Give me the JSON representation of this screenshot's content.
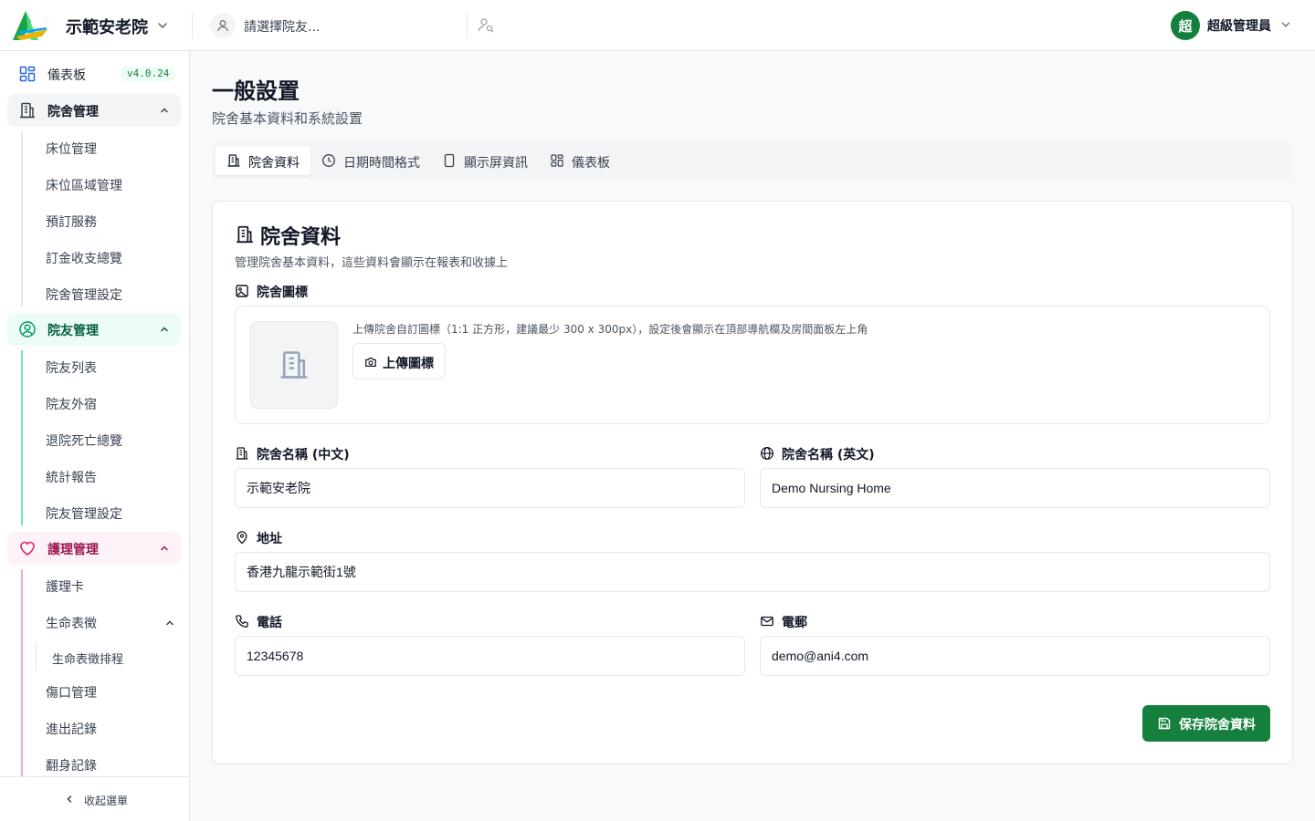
{
  "header": {
    "app_title": "示範安老院",
    "resident_placeholder": "請選擇院友...",
    "user_initial": "超",
    "user_name": "超級管理員"
  },
  "sidebar": {
    "dashboard_label": "儀表板",
    "version": "v4.0.24",
    "groups": [
      {
        "label": "院舍管理",
        "items": [
          "床位管理",
          "床位區域管理",
          "預訂服務",
          "訂金收支總覽",
          "院舍管理設定"
        ]
      },
      {
        "label": "院友管理",
        "items": [
          "院友列表",
          "院友外宿",
          "退院死亡總覽",
          "統計報告",
          "院友管理設定"
        ]
      },
      {
        "label": "護理管理",
        "items": [
          "護理卡",
          "生命表徵",
          "生命表徵排程",
          "傷口管理",
          "進出記錄",
          "翻身記錄"
        ]
      }
    ],
    "collapse_label": "收起選單"
  },
  "page": {
    "title": "一般設置",
    "subtitle": "院舍基本資料和系統設置"
  },
  "tabs": [
    "院舍資料",
    "日期時間格式",
    "顯示屏資訊",
    "儀表板"
  ],
  "card": {
    "title": "院舍資料",
    "description": "管理院舍基本資料，這些資料會顯示在報表和收據上",
    "logo_label": "院舍圖標",
    "logo_hint": "上傳院舍自訂圖標（1:1 正方形，建議最少 300 x 300px），設定後會顯示在頂部導航欄及房間面板左上角",
    "upload_label": "上傳圖標",
    "name_zh_label": "院舍名稱 (中文)",
    "name_zh_value": "示範安老院",
    "name_en_label": "院舍名稱 (英文)",
    "name_en_value": "Demo Nursing Home",
    "address_label": "地址",
    "address_value": "香港九龍示範街1號",
    "phone_label": "電話",
    "phone_value": "12345678",
    "email_label": "電郵",
    "email_value": "demo@ani4.com",
    "save_label": "保存院舍資料"
  },
  "colors": {
    "brand_green": "#15803d",
    "resident_accent": "#10b981",
    "care_accent": "#db2777"
  }
}
